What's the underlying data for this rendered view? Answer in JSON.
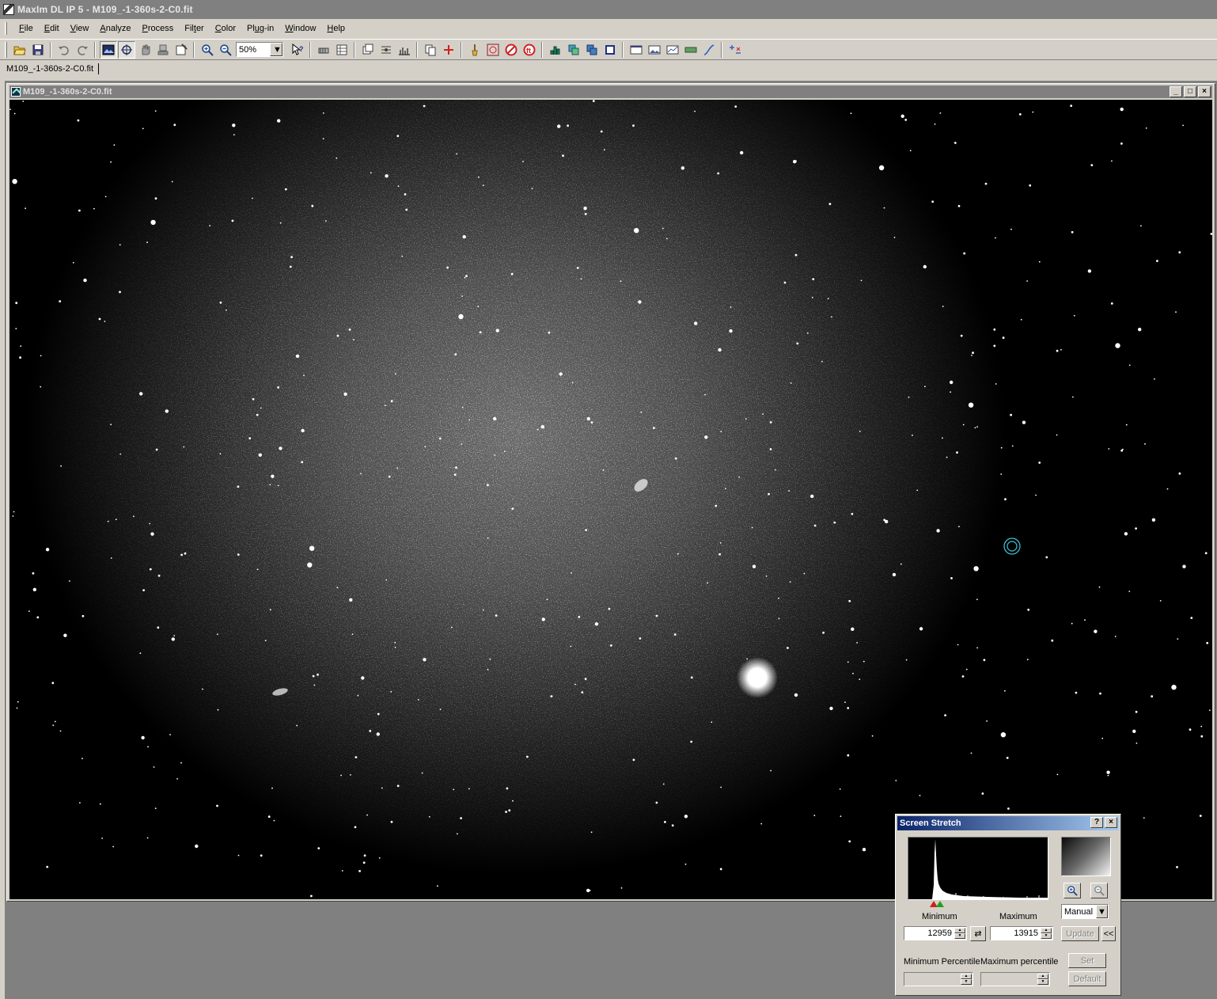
{
  "window": {
    "title": "MaxIm DL IP 5 - M109_-1-360s-2-C0.fit"
  },
  "menu": [
    {
      "pre": "",
      "u": "F",
      "post": "ile"
    },
    {
      "pre": "",
      "u": "E",
      "post": "dit"
    },
    {
      "pre": "",
      "u": "V",
      "post": "iew"
    },
    {
      "pre": "",
      "u": "A",
      "post": "nalyze"
    },
    {
      "pre": "",
      "u": "P",
      "post": "rocess"
    },
    {
      "pre": "Fil",
      "u": "t",
      "post": "er"
    },
    {
      "pre": "",
      "u": "C",
      "post": "olor"
    },
    {
      "pre": "Pl",
      "u": "u",
      "post": "g-in"
    },
    {
      "pre": "",
      "u": "W",
      "post": "indow"
    },
    {
      "pre": "",
      "u": "H",
      "post": "elp"
    }
  ],
  "toolbar": {
    "zoom": "50%"
  },
  "doc_tab": "M109_-1-360s-2-C0.fit",
  "image_window": {
    "title": "M109_-1-360s-2-C0.fit"
  },
  "screen_stretch": {
    "title": "Screen Stretch",
    "help": "?",
    "close": "×",
    "minimum_label": "Minimum",
    "maximum_label": "Maximum",
    "minimum_value": "12959",
    "maximum_value": "13915",
    "mode": "Manual",
    "update": "Update",
    "collapse": "<<",
    "min_percentile_label": "Minimum Percentile",
    "max_percentile_label": "Maximum percentile",
    "set": "Set",
    "default": "Default"
  },
  "colors": {
    "marker_low": "#d02020",
    "marker_high": "#20a020",
    "histogram": "#ffffff",
    "cursor_ring": "#40c8d8"
  }
}
